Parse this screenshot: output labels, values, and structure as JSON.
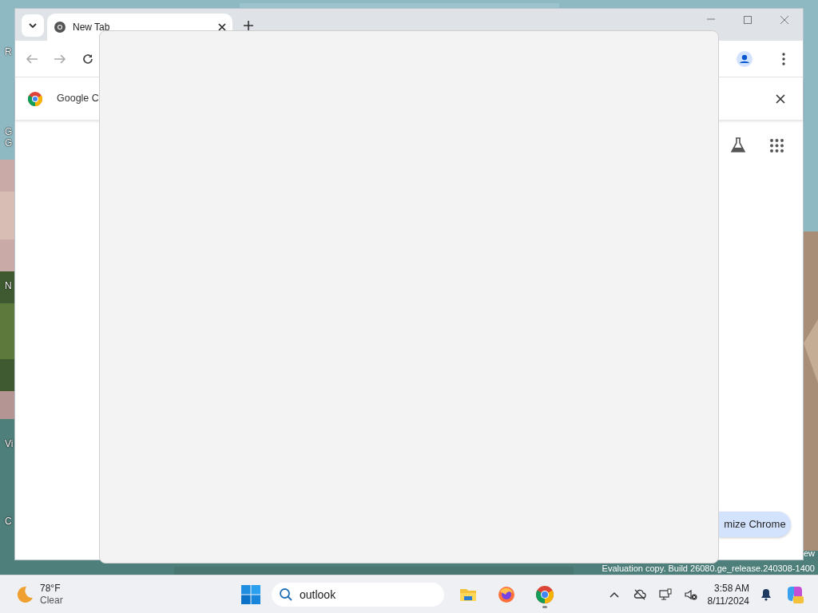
{
  "desktop": {
    "icon_labels": [
      "R",
      "G",
      "G",
      "N",
      "Vi",
      "C"
    ],
    "system_notice_lines": [
      "ew",
      "Evaluation copy. Build 26080.ge_release.240308-1400"
    ]
  },
  "browser": {
    "tabs": [
      {
        "title": "New Tab",
        "selected": true
      }
    ],
    "infobar": {
      "text": "Google C"
    },
    "customize_button": "mize Chrome"
  },
  "taskbar": {
    "weather": {
      "temperature": "78°F",
      "condition": "Clear"
    },
    "search": {
      "value": "outlook"
    },
    "apps": [
      {
        "kind": "files",
        "running": false
      },
      {
        "kind": "firefox",
        "running": false
      },
      {
        "kind": "chrome",
        "running": true
      }
    ],
    "clock": {
      "time": "3:58 AM",
      "date": "8/11/2024"
    }
  }
}
